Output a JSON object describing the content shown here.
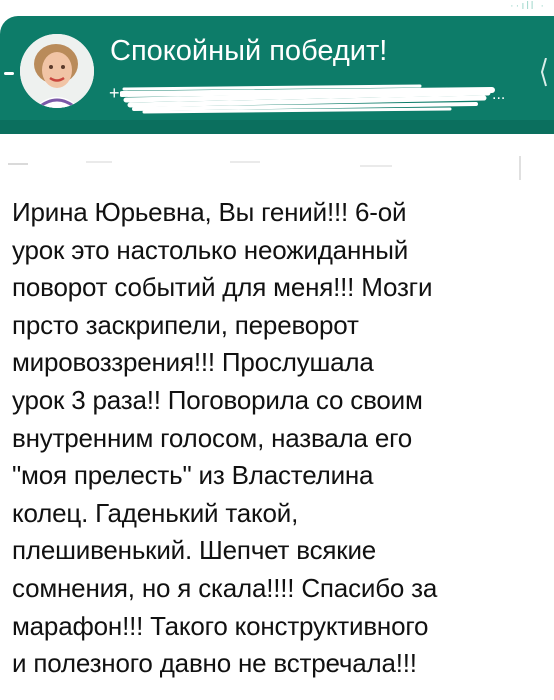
{
  "header": {
    "group_name": "Спокойный победит!",
    "member_prefix": "+",
    "member_ellipsis": "...",
    "header_color": "#0d7c69"
  },
  "status_bar": {
    "icons": "··ıll ·"
  },
  "icons": {
    "avatar": "contact-avatar-photo",
    "back": "back-arrow-icon",
    "menu": "overflow-menu-icon",
    "redaction": "redaction-scribble"
  },
  "message": {
    "text": "Ирина Юрьевна, Вы гений!!! 6-ой\nурок это настолько неожиданный\nповорот событий для меня!!! Мозги\nпрсто заскрипели, переворот\nмировоззрения!!! Прослушала\nурок 3 раза!! Поговорила со своим\nвнутренним голосом, назвала его\n\"моя прелесть\" из Властелина\nколец. Гаденький такой,\nплешивенький. Шепчет всякие\nсомнения, но я скала!!!! Спасибо за\nмарафон!!! Такого конструктивного\nи полезного давно не встречала!!!"
  }
}
